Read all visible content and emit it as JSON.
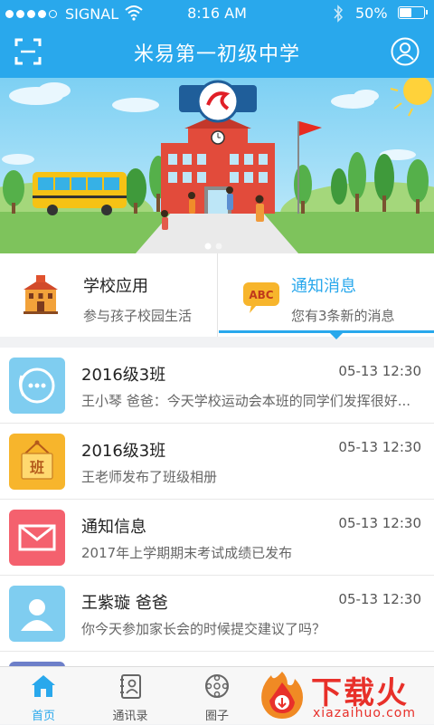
{
  "status_bar": {
    "carrier": "SIGNAL",
    "time": "8:16 AM",
    "battery_percent": "50%",
    "battery_level": 0.5,
    "signal_dots_filled": 4,
    "signal_dots_total": 5
  },
  "header": {
    "title": "米易第一初级中学",
    "left_icon": "scan-icon",
    "right_icon": "profile-icon"
  },
  "banner": {
    "image": "school-illustration",
    "slide_count": 2,
    "active_slide": 1
  },
  "cards": [
    {
      "title": "学校应用",
      "subtitle": "参与孩子校园生活",
      "icon": "school-building-icon",
      "selected": false
    },
    {
      "title": "通知消息",
      "subtitle": "您有3条新的消息",
      "icon": "abc-notice-icon",
      "selected": true
    }
  ],
  "messages": [
    {
      "name": "2016级3班",
      "date": "05-13 12:30",
      "text": "王小琴 爸爸：今天学校运动会本班的同学们发挥很好...",
      "avatar": "chat-bubble-icon",
      "color": "#7fcdf0"
    },
    {
      "name": "2016级3班",
      "date": "05-13 12:30",
      "text": "王老师发布了班级相册",
      "avatar": "class-sign-icon",
      "color": "#f7b52c"
    },
    {
      "name": "通知信息",
      "date": "05-13 12:30",
      "text": "2017年上学期期末考试成绩已发布",
      "avatar": "envelope-icon",
      "color": "#f4616e"
    },
    {
      "name": "王紫璇 爸爸",
      "date": "05-13 12:30",
      "text": "你今天参加家长会的时候提交建议了吗？",
      "avatar": "person-icon",
      "color": "#7fcdf0"
    }
  ],
  "tabbar": {
    "tabs": [
      {
        "label": "首页",
        "icon": "home-icon",
        "active": true
      },
      {
        "label": "通讯录",
        "icon": "contacts-book-icon",
        "active": false
      },
      {
        "label": "圈子",
        "icon": "circle-dots-icon",
        "active": false
      }
    ]
  },
  "watermark": {
    "big": "下载火",
    "small": "xiazaihuo.com"
  },
  "colors": {
    "primary": "#29a8ec",
    "accent_red": "#e8302a"
  }
}
